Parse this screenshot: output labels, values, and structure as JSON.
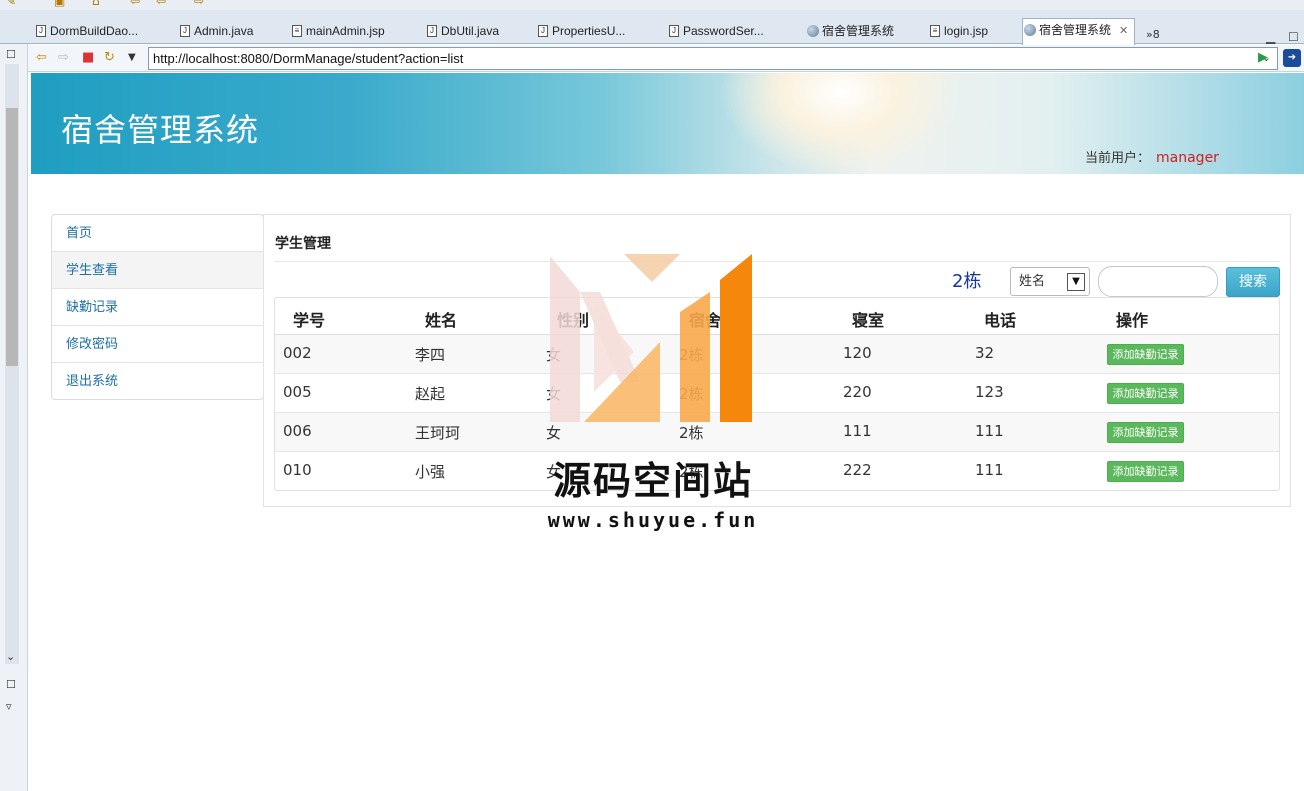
{
  "ide": {
    "tabs": [
      {
        "label": "DormBuildDao...",
        "icon": "java-file-icon"
      },
      {
        "label": "Admin.java",
        "icon": "java-file-icon"
      },
      {
        "label": "mainAdmin.jsp",
        "icon": "jsp-file-icon"
      },
      {
        "label": "DbUtil.java",
        "icon": "java-file-icon"
      },
      {
        "label": "PropertiesU...",
        "icon": "java-file-icon"
      },
      {
        "label": "PasswordSer...",
        "icon": "java-file-icon"
      },
      {
        "label": "宿舍管理系统",
        "icon": "globe-icon"
      },
      {
        "label": "login.jsp",
        "icon": "jsp-file-icon"
      },
      {
        "label": "宿舍管理系统",
        "icon": "globe-icon",
        "active": true
      }
    ],
    "overflow_count": "»8",
    "url": "http://localhost:8080/DormManage/student?action=list"
  },
  "header": {
    "title": "宿舍管理系统",
    "current_user_label": "当前用户：",
    "current_user": "manager"
  },
  "sidebar": {
    "items": [
      {
        "label": "首页"
      },
      {
        "label": "学生查看",
        "active": true
      },
      {
        "label": "缺勤记录"
      },
      {
        "label": "修改密码"
      },
      {
        "label": "退出系统"
      }
    ]
  },
  "main": {
    "heading": "学生管理",
    "building": "2栋",
    "search": {
      "field_selected": "姓名",
      "value": "",
      "button_label": "搜索"
    },
    "table": {
      "columns": [
        "学号",
        "姓名",
        "性别",
        "宿舍楼",
        "寝室",
        "电话",
        "操作"
      ],
      "rows": [
        {
          "id": "002",
          "name": "李四",
          "gender": "女",
          "building": "2栋",
          "room": "120",
          "phone": "32",
          "action": "添加缺勤记录"
        },
        {
          "id": "005",
          "name": "赵起",
          "gender": "女",
          "building": "2栋",
          "room": "220",
          "phone": "123",
          "action": "添加缺勤记录"
        },
        {
          "id": "006",
          "name": "王珂珂",
          "gender": "女",
          "building": "2栋",
          "room": "111",
          "phone": "111",
          "action": "添加缺勤记录"
        },
        {
          "id": "010",
          "name": "小强",
          "gender": "女",
          "building": "2栋",
          "room": "222",
          "phone": "111",
          "action": "添加缺勤记录"
        }
      ]
    }
  },
  "watermark": {
    "text": "源码空间站",
    "url": "www.shuyue.fun",
    "colors": {
      "orange": "#f5870c",
      "light_orange": "#f9b86a",
      "pink": "#f3d9d6"
    }
  }
}
